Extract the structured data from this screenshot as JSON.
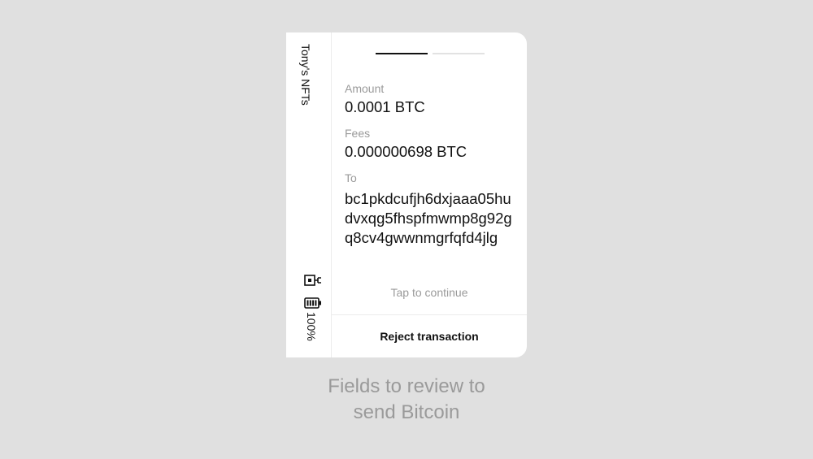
{
  "device": {
    "name": "Tony's NFTs",
    "battery": "100%",
    "usb_icon": "usb-connection-icon",
    "battery_icon": "battery-full-icon"
  },
  "pager": {
    "total": 2,
    "active": 1
  },
  "transaction": {
    "fields": [
      {
        "label": "Amount",
        "value": "0.0001 BTC"
      },
      {
        "label": "Fees",
        "value": "0.000000698 BTC"
      },
      {
        "label": "To",
        "value": "bc1pkdcufjh6dxjaaa05hudvxqg5fhspfmwmp8g92gq8cv4gwwnmgrfqfd4jlg"
      }
    ],
    "tap_hint": "Tap to continue",
    "reject_label": "Reject transaction"
  },
  "caption": "Fields to review to\nsend Bitcoin",
  "colors": {
    "background": "#e0e0e0",
    "panel": "#ffffff",
    "text": "#111111",
    "muted": "#9a9a9a"
  }
}
